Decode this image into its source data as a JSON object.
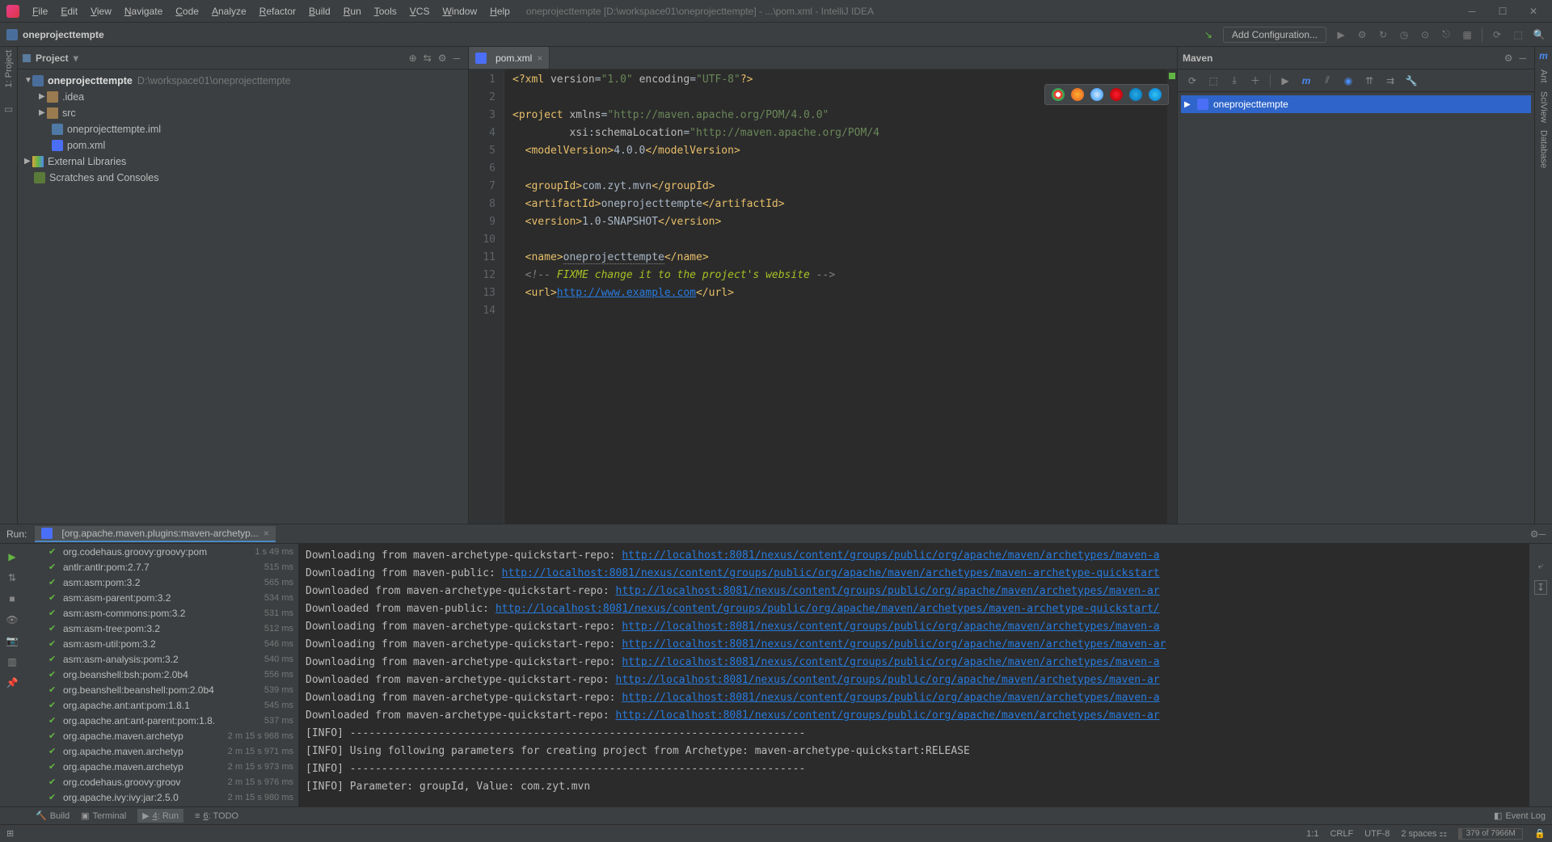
{
  "window_title": "oneprojecttempte [D:\\workspace01\\oneprojecttempte] - ...\\pom.xml - IntelliJ IDEA",
  "menu": [
    "File",
    "Edit",
    "View",
    "Navigate",
    "Code",
    "Analyze",
    "Refactor",
    "Build",
    "Run",
    "Tools",
    "VCS",
    "Window",
    "Help"
  ],
  "breadcrumb": "oneprojecttempte",
  "add_config": "Add Configuration...",
  "left_tabs": [
    "1: Project"
  ],
  "right_tabs": [
    "Maven",
    "Ant",
    "SciView",
    "Database"
  ],
  "project_panel": {
    "title": "Project",
    "root": {
      "name": "oneprojecttempte",
      "path": "D:\\workspace01\\oneprojecttempte"
    },
    "children": [
      {
        "name": ".idea",
        "type": "folder"
      },
      {
        "name": "src",
        "type": "folder"
      },
      {
        "name": "oneprojecttempte.iml",
        "type": "file"
      },
      {
        "name": "pom.xml",
        "type": "m"
      }
    ],
    "ext_libs": "External Libraries",
    "scratches": "Scratches and Consoles"
  },
  "editor": {
    "tab_label": "pom.xml",
    "lines": [
      {
        "n": 1,
        "html": "<span class='tag'>&lt;?xml</span> <span class='attr'>version</span>=<span class='str'>\"1.0\"</span> <span class='attr'>encoding</span>=<span class='str'>\"UTF-8\"</span><span class='tag'>?&gt;</span>"
      },
      {
        "n": 2,
        "html": ""
      },
      {
        "n": 3,
        "html": "<span class='tag'>&lt;project</span> <span class='attr'>xmlns</span>=<span class='str'>\"http://maven.apache.org/POM/4.0.0\"</span>"
      },
      {
        "n": 4,
        "html": "         <span class='attr'>xsi</span>:<span class='attr'>schemaLocation</span>=<span class='str'>\"http://maven.apache.org/POM/4</span>"
      },
      {
        "n": 5,
        "html": "  <span class='tag'>&lt;modelVersion&gt;</span>4.0.0<span class='tag'>&lt;/modelVersion&gt;</span>"
      },
      {
        "n": 6,
        "html": ""
      },
      {
        "n": 7,
        "html": "  <span class='tag'>&lt;groupId&gt;</span>com.zyt.mvn<span class='tag'>&lt;/groupId&gt;</span>"
      },
      {
        "n": 8,
        "html": "  <span class='tag'>&lt;artifactId&gt;</span>oneprojecttempte<span class='tag'>&lt;/artifactId&gt;</span>"
      },
      {
        "n": 9,
        "html": "  <span class='tag'>&lt;version&gt;</span>1.0-SNAPSHOT<span class='tag'>&lt;/version&gt;</span>"
      },
      {
        "n": 10,
        "html": ""
      },
      {
        "n": 11,
        "html": "  <span class='tag'>&lt;name&gt;</span><span style='border-bottom:1px dotted #888'>oneprojecttempte</span><span class='tag'>&lt;/name&gt;</span>"
      },
      {
        "n": 12,
        "html": "  <span class='comment'>&lt;!--</span> <span class='fixme'>FIXME change it to the project's website</span> <span class='comment'>--&gt;</span>"
      },
      {
        "n": 13,
        "html": "  <span class='tag'>&lt;url&gt;</span><span class='link u'>http://www.example.com</span><span class='tag'>&lt;/url&gt;</span>"
      },
      {
        "n": 14,
        "html": ""
      }
    ]
  },
  "maven": {
    "title": "Maven",
    "project": "oneprojecttempte"
  },
  "run": {
    "label": "Run:",
    "tab": "[org.apache.maven.plugins:maven-archetyp...",
    "tasks": [
      {
        "name": "org.codehaus.groovy:groovy:pom",
        "dur": "1 s 49 ms"
      },
      {
        "name": "antlr:antlr:pom:2.7.7",
        "dur": "515 ms"
      },
      {
        "name": "asm:asm:pom:3.2",
        "dur": "565 ms"
      },
      {
        "name": "asm:asm-parent:pom:3.2",
        "dur": "534 ms"
      },
      {
        "name": "asm:asm-commons:pom:3.2",
        "dur": "531 ms"
      },
      {
        "name": "asm:asm-tree:pom:3.2",
        "dur": "512 ms"
      },
      {
        "name": "asm:asm-util:pom:3.2",
        "dur": "546 ms"
      },
      {
        "name": "asm:asm-analysis:pom:3.2",
        "dur": "540 ms"
      },
      {
        "name": "org.beanshell:bsh:pom:2.0b4",
        "dur": "556 ms"
      },
      {
        "name": "org.beanshell:beanshell:pom:2.0b4",
        "dur": "539 ms"
      },
      {
        "name": "org.apache.ant:ant:pom:1.8.1",
        "dur": "545 ms"
      },
      {
        "name": "org.apache.ant:ant-parent:pom:1.8.",
        "dur": "537 ms"
      },
      {
        "name": "org.apache.maven.archetyp",
        "dur": "2 m 15 s 968 ms"
      },
      {
        "name": "org.apache.maven.archetyp",
        "dur": "2 m 15 s 971 ms"
      },
      {
        "name": "org.apache.maven.archetyp",
        "dur": "2 m 15 s 973 ms"
      },
      {
        "name": "org.codehaus.groovy:groov",
        "dur": "2 m 15 s 976 ms"
      },
      {
        "name": "org.apache.ivy:ivy:jar:2.5.0",
        "dur": "2 m 15 s 980 ms"
      }
    ],
    "console": [
      {
        "pre": "Downloading from maven-archetype-quickstart-repo: ",
        "url": "http://localhost:8081/nexus/content/groups/public/org/apache/maven/archetypes/maven-a"
      },
      {
        "pre": "Downloading from maven-public: ",
        "url": "http://localhost:8081/nexus/content/groups/public/org/apache/maven/archetypes/maven-archetype-quickstart"
      },
      {
        "pre": "Downloaded from maven-archetype-quickstart-repo: ",
        "url": "http://localhost:8081/nexus/content/groups/public/org/apache/maven/archetypes/maven-ar"
      },
      {
        "pre": "Downloaded from maven-public: ",
        "url": "http://localhost:8081/nexus/content/groups/public/org/apache/maven/archetypes/maven-archetype-quickstart/"
      },
      {
        "pre": "Downloading from maven-archetype-quickstart-repo: ",
        "url": "http://localhost:8081/nexus/content/groups/public/org/apache/maven/archetypes/maven-a"
      },
      {
        "pre": "Downloading from maven-archetype-quickstart-repo: ",
        "url": "http://localhost:8081/nexus/content/groups/public/org/apache/maven/archetypes/maven-ar"
      },
      {
        "pre": "Downloading from maven-archetype-quickstart-repo: ",
        "url": "http://localhost:8081/nexus/content/groups/public/org/apache/maven/archetypes/maven-a"
      },
      {
        "pre": "Downloaded from maven-archetype-quickstart-repo: ",
        "url": "http://localhost:8081/nexus/content/groups/public/org/apache/maven/archetypes/maven-ar"
      },
      {
        "pre": "Downloading from maven-archetype-quickstart-repo: ",
        "url": "http://localhost:8081/nexus/content/groups/public/org/apache/maven/archetypes/maven-a"
      },
      {
        "pre": "Downloaded from maven-archetype-quickstart-repo: ",
        "url": "http://localhost:8081/nexus/content/groups/public/org/apache/maven/archetypes/maven-ar"
      },
      {
        "text": "[INFO] ------------------------------------------------------------------------"
      },
      {
        "text": "[INFO] Using following parameters for creating project from Archetype: maven-archetype-quickstart:RELEASE"
      },
      {
        "text": "[INFO] ------------------------------------------------------------------------"
      },
      {
        "text": "[INFO] Parameter: groupId, Value: com.zyt.mvn"
      }
    ]
  },
  "tool_buttons": {
    "build": "Build",
    "terminal": "Terminal",
    "run": "4: Run",
    "todo": "6: TODO",
    "event_log": "Event Log"
  },
  "status": {
    "pos": "1:1",
    "sep": "CRLF",
    "enc": "UTF-8",
    "indent": "2 spaces",
    "mem": "379 of 7966M"
  }
}
